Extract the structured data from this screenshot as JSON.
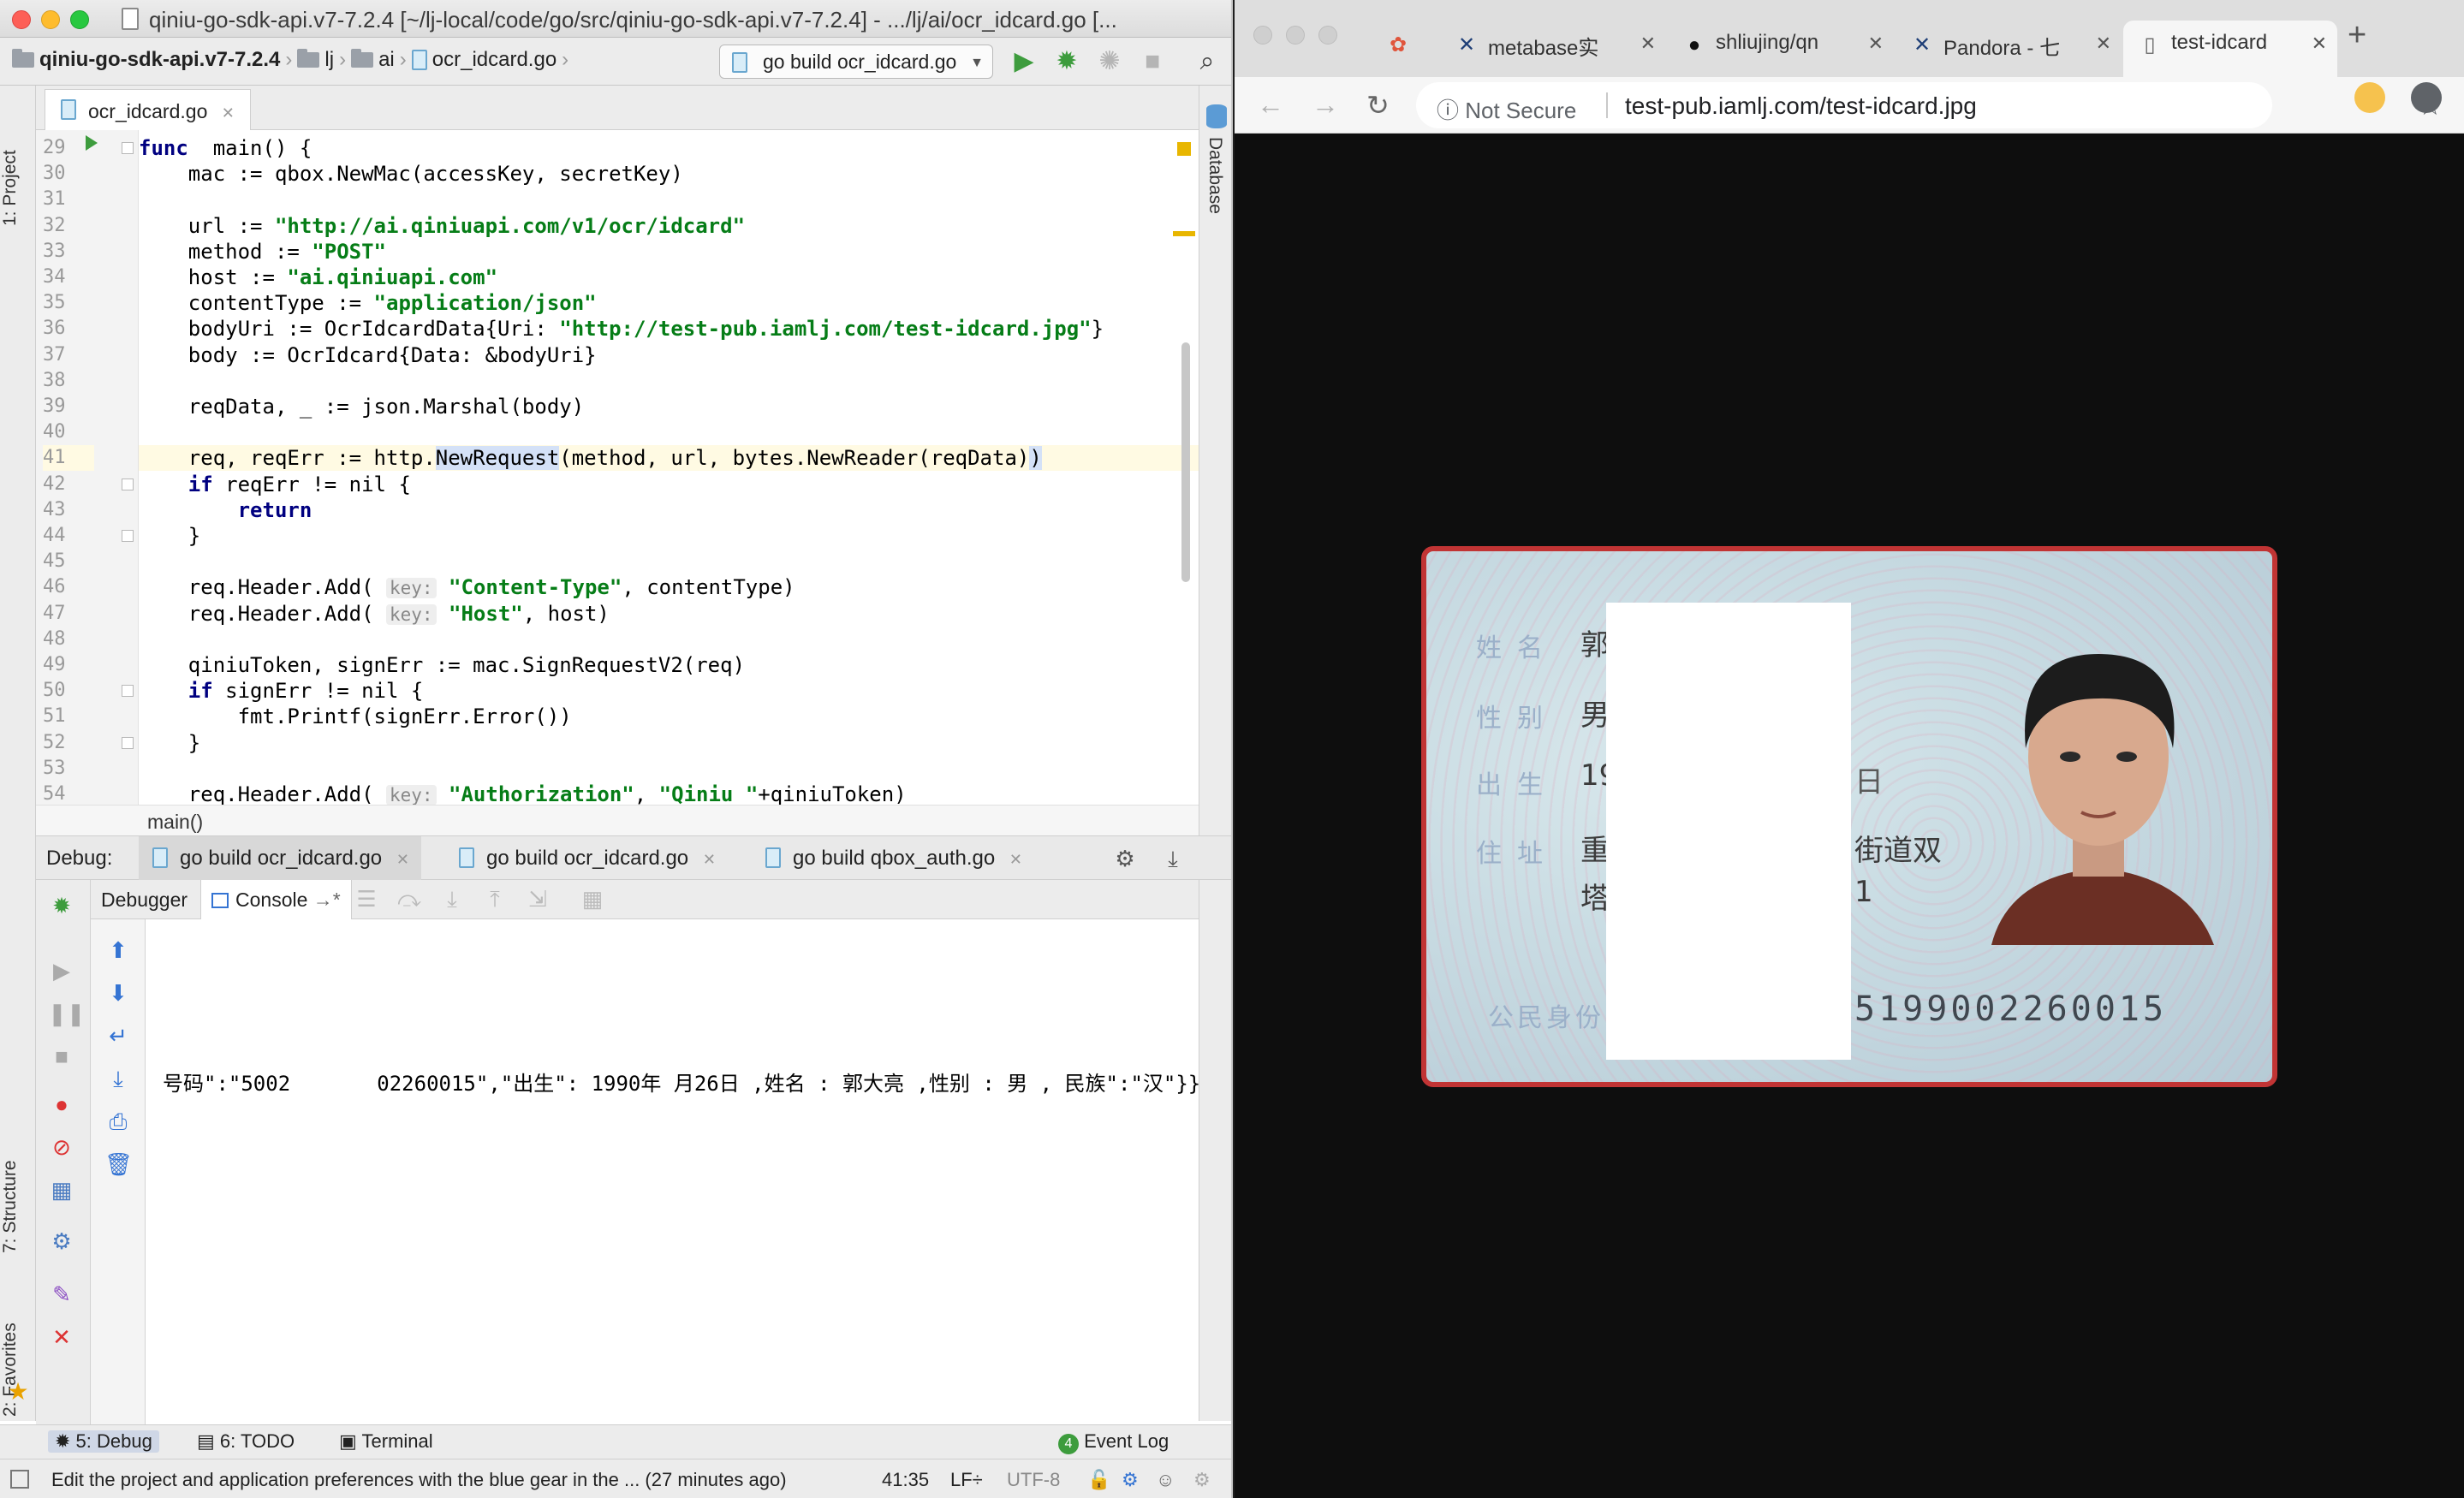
{
  "ide": {
    "window_title": "qiniu-go-sdk-api.v7-7.2.4 [~/lj-local/code/go/src/qiniu-go-sdk-api.v7-7.2.4] - .../lj/ai/ocr_idcard.go [...",
    "breadcrumb": [
      "qiniu-go-sdk-api.v7-7.2.4",
      "lj",
      "ai",
      "ocr_idcard.go"
    ],
    "run_config": "go build ocr_idcard.go",
    "file_tab": "ocr_idcard.go",
    "side_tabs": {
      "project": "1: Project",
      "structure": "7: Structure",
      "favorites": "2: Favorites",
      "database": "Database"
    },
    "code_lines": [
      {
        "n": "29",
        "parts": [
          [
            "kw",
            "func"
          ],
          [
            "",
            "  main() {"
          ]
        ]
      },
      {
        "n": "30",
        "parts": [
          [
            "",
            "    mac := qbox.NewMac(accessKey, secretKey)"
          ]
        ]
      },
      {
        "n": "31",
        "parts": [
          [
            "",
            ""
          ]
        ]
      },
      {
        "n": "32",
        "parts": [
          [
            "",
            "    url := "
          ],
          [
            "str",
            "\"http://ai.qiniuapi.com/v1/ocr/idcard\""
          ]
        ]
      },
      {
        "n": "33",
        "parts": [
          [
            "",
            "    method := "
          ],
          [
            "str",
            "\"POST\""
          ]
        ]
      },
      {
        "n": "34",
        "parts": [
          [
            "",
            "    host := "
          ],
          [
            "str",
            "\"ai.qiniuapi.com\""
          ]
        ]
      },
      {
        "n": "35",
        "parts": [
          [
            "",
            "    contentType := "
          ],
          [
            "str",
            "\"application/json\""
          ]
        ]
      },
      {
        "n": "36",
        "parts": [
          [
            "",
            "    bodyUri := OcrIdcardData{Uri: "
          ],
          [
            "str",
            "\"http://test-pub.iamlj.com/test-idcard.jpg\""
          ],
          [
            "",
            "}"
          ]
        ]
      },
      {
        "n": "37",
        "parts": [
          [
            "",
            "    body := OcrIdcard{Data: &bodyUri}"
          ]
        ]
      },
      {
        "n": "38",
        "parts": [
          [
            "",
            ""
          ]
        ]
      },
      {
        "n": "39",
        "parts": [
          [
            "",
            "    reqData, _ := json.Marshal(body)"
          ]
        ]
      },
      {
        "n": "40",
        "parts": [
          [
            "",
            ""
          ]
        ]
      },
      {
        "n": "41",
        "parts": [
          [
            "",
            "    req, reqErr := http."
          ],
          [
            "hl",
            "NewRequest"
          ],
          [
            "",
            "(method, url, bytes.NewReader(reqData)"
          ],
          [
            "hl",
            ")"
          ]
        ]
      },
      {
        "n": "42",
        "parts": [
          [
            "",
            "    "
          ],
          [
            "kw",
            "if"
          ],
          [
            "",
            " reqErr != nil {"
          ]
        ]
      },
      {
        "n": "43",
        "parts": [
          [
            "",
            "        "
          ],
          [
            "kw",
            "return"
          ]
        ]
      },
      {
        "n": "44",
        "parts": [
          [
            "",
            "    }"
          ]
        ]
      },
      {
        "n": "45",
        "parts": [
          [
            "",
            ""
          ]
        ]
      },
      {
        "n": "46",
        "parts": [
          [
            "",
            "    req.Header.Add( "
          ],
          [
            "hint",
            "key:"
          ],
          [
            "",
            " "
          ],
          [
            "str",
            "\"Content-Type\""
          ],
          [
            "",
            ", contentType)"
          ]
        ]
      },
      {
        "n": "47",
        "parts": [
          [
            "",
            "    req.Header.Add( "
          ],
          [
            "hint",
            "key:"
          ],
          [
            "",
            " "
          ],
          [
            "str",
            "\"Host\""
          ],
          [
            "",
            ", host)"
          ]
        ]
      },
      {
        "n": "48",
        "parts": [
          [
            "",
            ""
          ]
        ]
      },
      {
        "n": "49",
        "parts": [
          [
            "",
            "    qiniuToken, signErr := mac.SignRequestV2(req)"
          ]
        ]
      },
      {
        "n": "50",
        "parts": [
          [
            "",
            "    "
          ],
          [
            "kw",
            "if"
          ],
          [
            "",
            " signErr != nil {"
          ]
        ]
      },
      {
        "n": "51",
        "parts": [
          [
            "",
            "        fmt.Printf(signErr.Error())"
          ]
        ]
      },
      {
        "n": "52",
        "parts": [
          [
            "",
            "    }"
          ]
        ]
      },
      {
        "n": "53",
        "parts": [
          [
            "",
            ""
          ]
        ]
      },
      {
        "n": "54",
        "parts": [
          [
            "",
            "    req.Header.Add( "
          ],
          [
            "hint",
            "key:"
          ],
          [
            "",
            " "
          ],
          [
            "str",
            "\"Authorization\""
          ],
          [
            "",
            ", "
          ],
          [
            "str",
            "\"Qiniu \""
          ],
          [
            "",
            "+qiniuToken)"
          ]
        ]
      }
    ],
    "function_breadcrumb": "main()",
    "debug": {
      "label": "Debug:",
      "tabs": [
        "go build ocr_idcard.go",
        "go build ocr_idcard.go",
        "go build qbox_auth.go"
      ],
      "subtabs": {
        "debugger": "Debugger",
        "console": "Console"
      },
      "console_output": "号码\":\"5002       02260015\",\"出生\": 1990年 月26日 ,姓名 : 郭大亮 ,性别 : 男 , 民族\":\"汉\"}}}"
    },
    "bottom_tools": [
      "5: Debug",
      "6: TODO",
      "Terminal",
      "Event Log"
    ],
    "event_log_count": "4",
    "status": {
      "message": "Edit the project and application preferences with the blue gear in the ... (27 minutes ago)",
      "position": "41:35",
      "line_sep": "LF÷",
      "encoding": "UTF-8"
    }
  },
  "browser": {
    "tabs": [
      {
        "label": "",
        "icon": "photos-icon"
      },
      {
        "label": "metabase实",
        "icon": "metabase-icon"
      },
      {
        "label": "shliujing/qn",
        "icon": "github-icon"
      },
      {
        "label": "Pandora - 七",
        "icon": "pandora-icon"
      },
      {
        "label": "test-idcard",
        "icon": "page-icon",
        "active": true
      }
    ],
    "security_label": "Not Secure",
    "url": "test-pub.iamlj.com/test-idcard.jpg",
    "card": {
      "labels": [
        "姓名",
        "性别",
        "出生",
        "住址",
        "公民身份"
      ],
      "values": [
        "郭",
        "男",
        "19",
        "重",
        "塔"
      ],
      "address_tail": "街道双",
      "address_tail2": "1",
      "id_number_tail": "5199002260015",
      "birth_tail": "日"
    }
  }
}
